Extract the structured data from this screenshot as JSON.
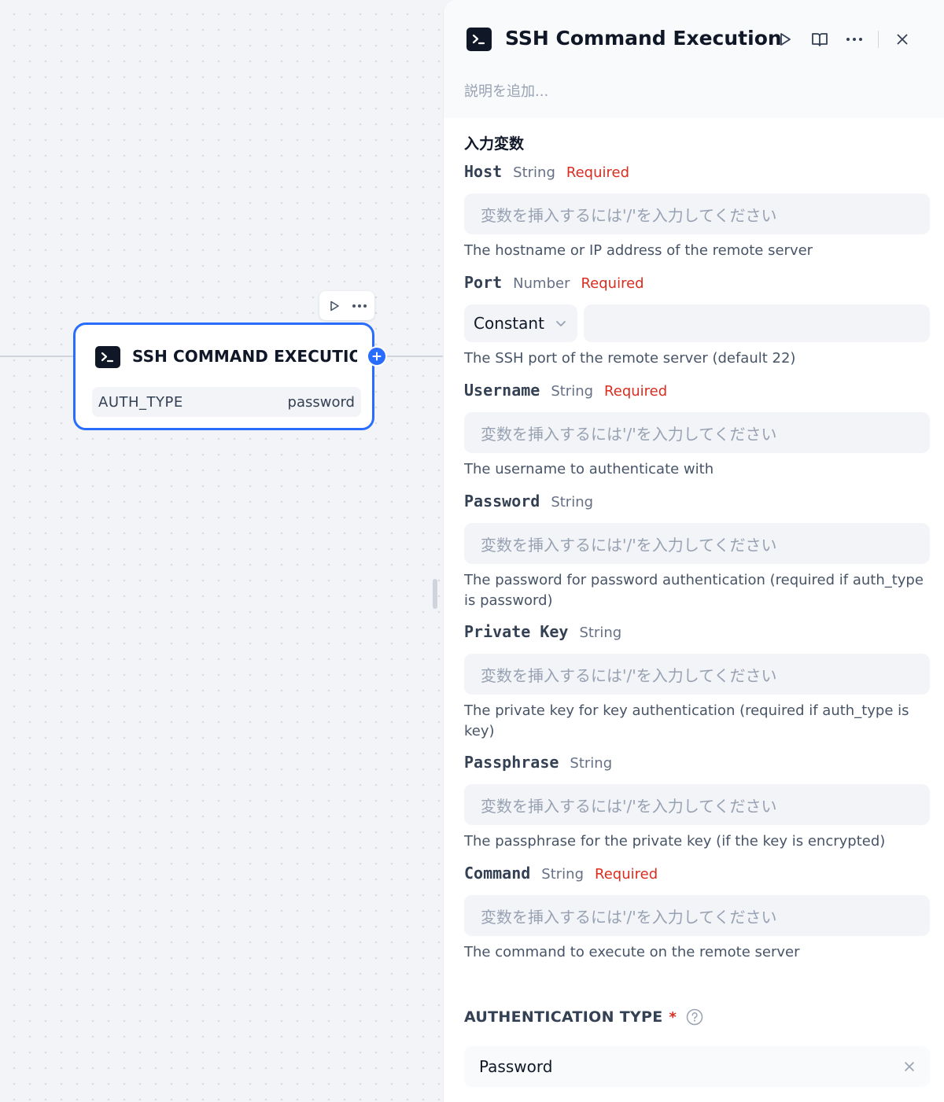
{
  "canvas": {
    "node": {
      "title": "SSH COMMAND EXECUTION",
      "icon": "terminal-icon",
      "field_key": "AUTH_TYPE",
      "field_value": "password"
    },
    "toolbar": {
      "run_icon": "play-icon",
      "more_icon": "more-icon"
    },
    "accent_color": "#296dff"
  },
  "panel": {
    "title": "SSH Command Execution",
    "icon": "terminal-icon",
    "description_placeholder": "説明を追加...",
    "actions": [
      "play-icon",
      "book-icon",
      "more-icon",
      "close-icon"
    ],
    "section_title": "入力変数",
    "placeholder": "変数を挿入するには'/'を入力してください",
    "fields": [
      {
        "name": "Host",
        "type": "String",
        "required": "Required",
        "help": "The hostname or IP address of the remote server"
      },
      {
        "name": "Port",
        "type": "Number",
        "required": "Required",
        "mode": "Constant",
        "help": "The SSH port of the remote server (default 22)"
      },
      {
        "name": "Username",
        "type": "String",
        "required": "Required",
        "help": "The username to authenticate with"
      },
      {
        "name": "Password",
        "type": "String",
        "help": "The password for password authentication (required if auth_type is password)"
      },
      {
        "name": "Private Key",
        "type": "String",
        "help": "The private key for key authentication (required if auth_type is key)"
      },
      {
        "name": "Passphrase",
        "type": "String",
        "help": "The passphrase for the private key (if the key is encrypted)"
      },
      {
        "name": "Command",
        "type": "String",
        "required": "Required",
        "help": "The command to execute on the remote server"
      }
    ],
    "auth": {
      "label": "AUTHENTICATION TYPE",
      "required_mark": "*",
      "value": "Password"
    },
    "required_color": "#d92d20"
  }
}
